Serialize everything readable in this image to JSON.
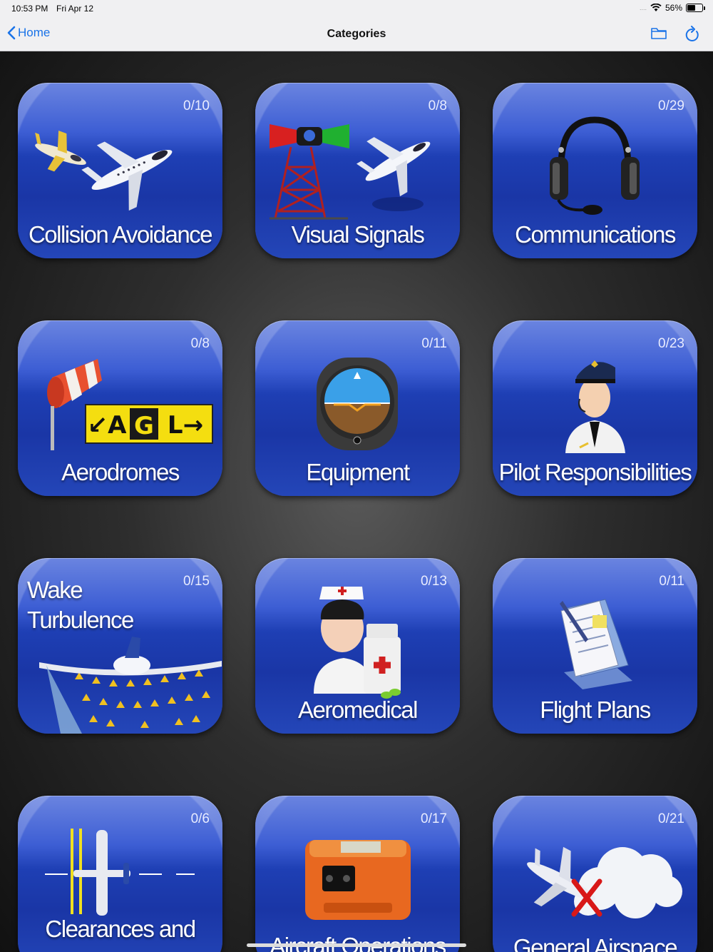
{
  "status_bar": {
    "time": "10:53 PM",
    "date": "Fri Apr 12",
    "signal": "....",
    "battery": "56%",
    "battery_level": 0.56
  },
  "nav": {
    "back_label": "Home",
    "title": "Categories",
    "folder_icon": "folder-icon",
    "refresh_icon": "refresh-icon"
  },
  "tiles": [
    {
      "label": "Collision Avoidance",
      "count": "0/10",
      "icon": "airplanes-icon"
    },
    {
      "label": "Visual Signals",
      "count": "0/8",
      "icon": "light-gun-tower-icon"
    },
    {
      "label": "Communications",
      "count": "0/29",
      "icon": "headset-icon"
    },
    {
      "label": "Aerodromes",
      "count": "0/8",
      "icon": "windsock-sign-icon",
      "sign_letters": [
        "↙A",
        "G",
        "L→"
      ]
    },
    {
      "label": "Equipment",
      "count": "0/11",
      "icon": "attitude-indicator-icon"
    },
    {
      "label": "Pilot Responsibilities",
      "count": "0/23",
      "icon": "pilot-icon"
    },
    {
      "label_line1": "Wake",
      "label_line2": "Turbulence",
      "count": "0/15",
      "icon": "wake-turbulence-icon"
    },
    {
      "label": "Aeromedical",
      "count": "0/13",
      "icon": "nurse-medicine-icon"
    },
    {
      "label": "Flight Plans",
      "count": "0/11",
      "icon": "documents-pen-icon"
    },
    {
      "label": "Clearances and",
      "count": "0/6",
      "icon": "runway-airplane-icon"
    },
    {
      "label": "Aircraft Operations",
      "count": "0/17",
      "icon": "elt-device-icon"
    },
    {
      "label": "General Airspace",
      "count": "0/21",
      "icon": "airplane-cloud-icon"
    }
  ],
  "colors": {
    "accent": "#1a73e8",
    "tile_blue": "#1e3fb4"
  }
}
